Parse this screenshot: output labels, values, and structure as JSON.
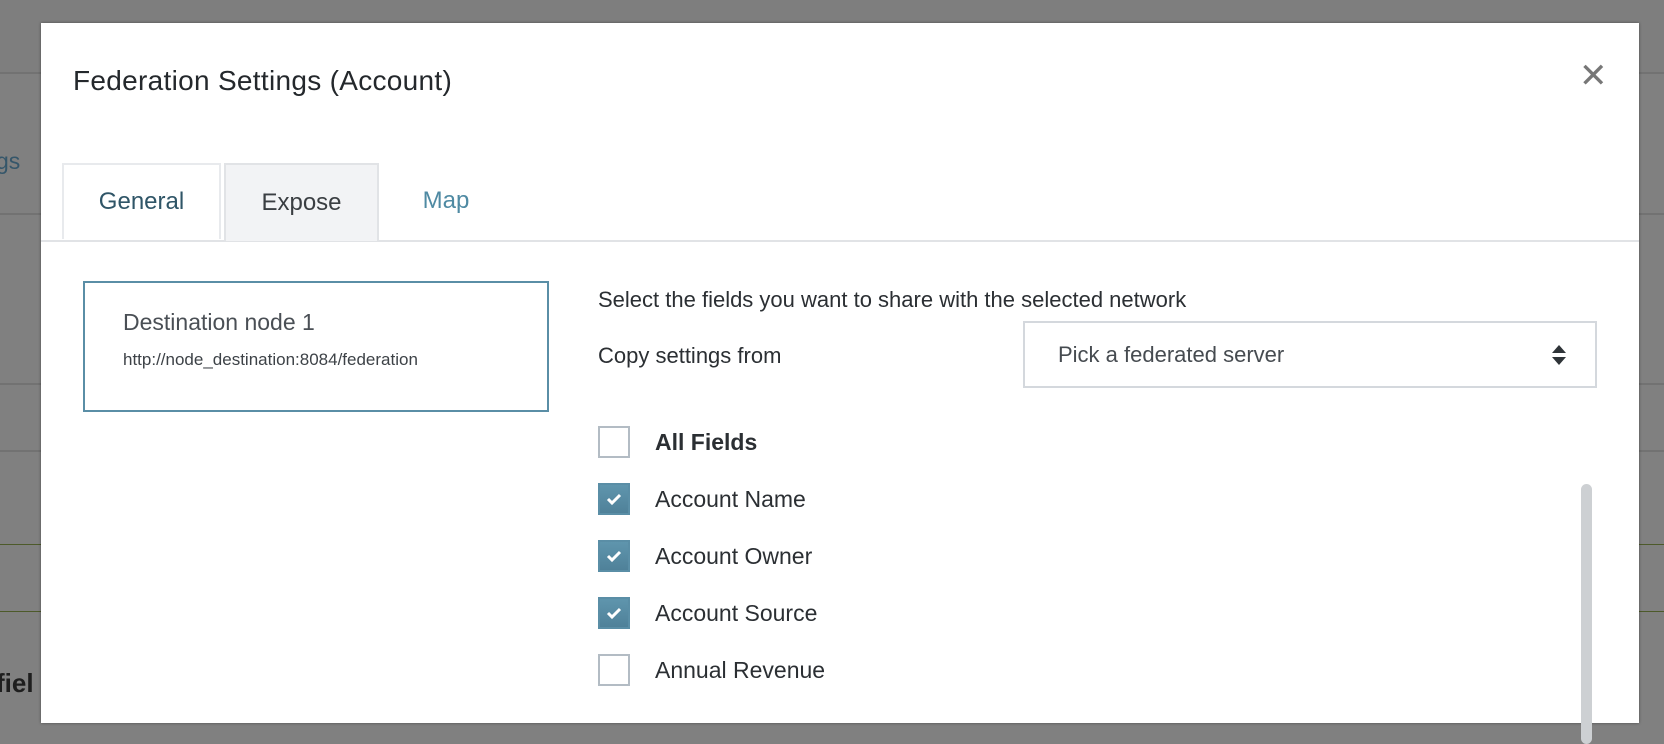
{
  "background": {
    "partial_text_top": "gs",
    "partial_text_bottom": "fiel"
  },
  "modal": {
    "title": "Federation Settings (Account)",
    "close_icon": "close-x-icon",
    "tabs": [
      {
        "label": "General",
        "active": false
      },
      {
        "label": "Expose",
        "active": true
      },
      {
        "label": "Map",
        "active": false
      }
    ],
    "node": {
      "name": "Destination node 1",
      "url": "http://node_destination:8084/federation"
    },
    "intro": "Select the fields you want to share with the selected network",
    "copy_settings": {
      "label": "Copy settings from",
      "placeholder": "Pick a federated server"
    },
    "fields": [
      {
        "label": "All Fields",
        "checked": false
      },
      {
        "label": "Account Name",
        "checked": true
      },
      {
        "label": "Account Owner",
        "checked": true
      },
      {
        "label": "Account Source",
        "checked": true
      },
      {
        "label": "Annual Revenue",
        "checked": false
      }
    ],
    "accent_color": "#5a8ea6"
  }
}
